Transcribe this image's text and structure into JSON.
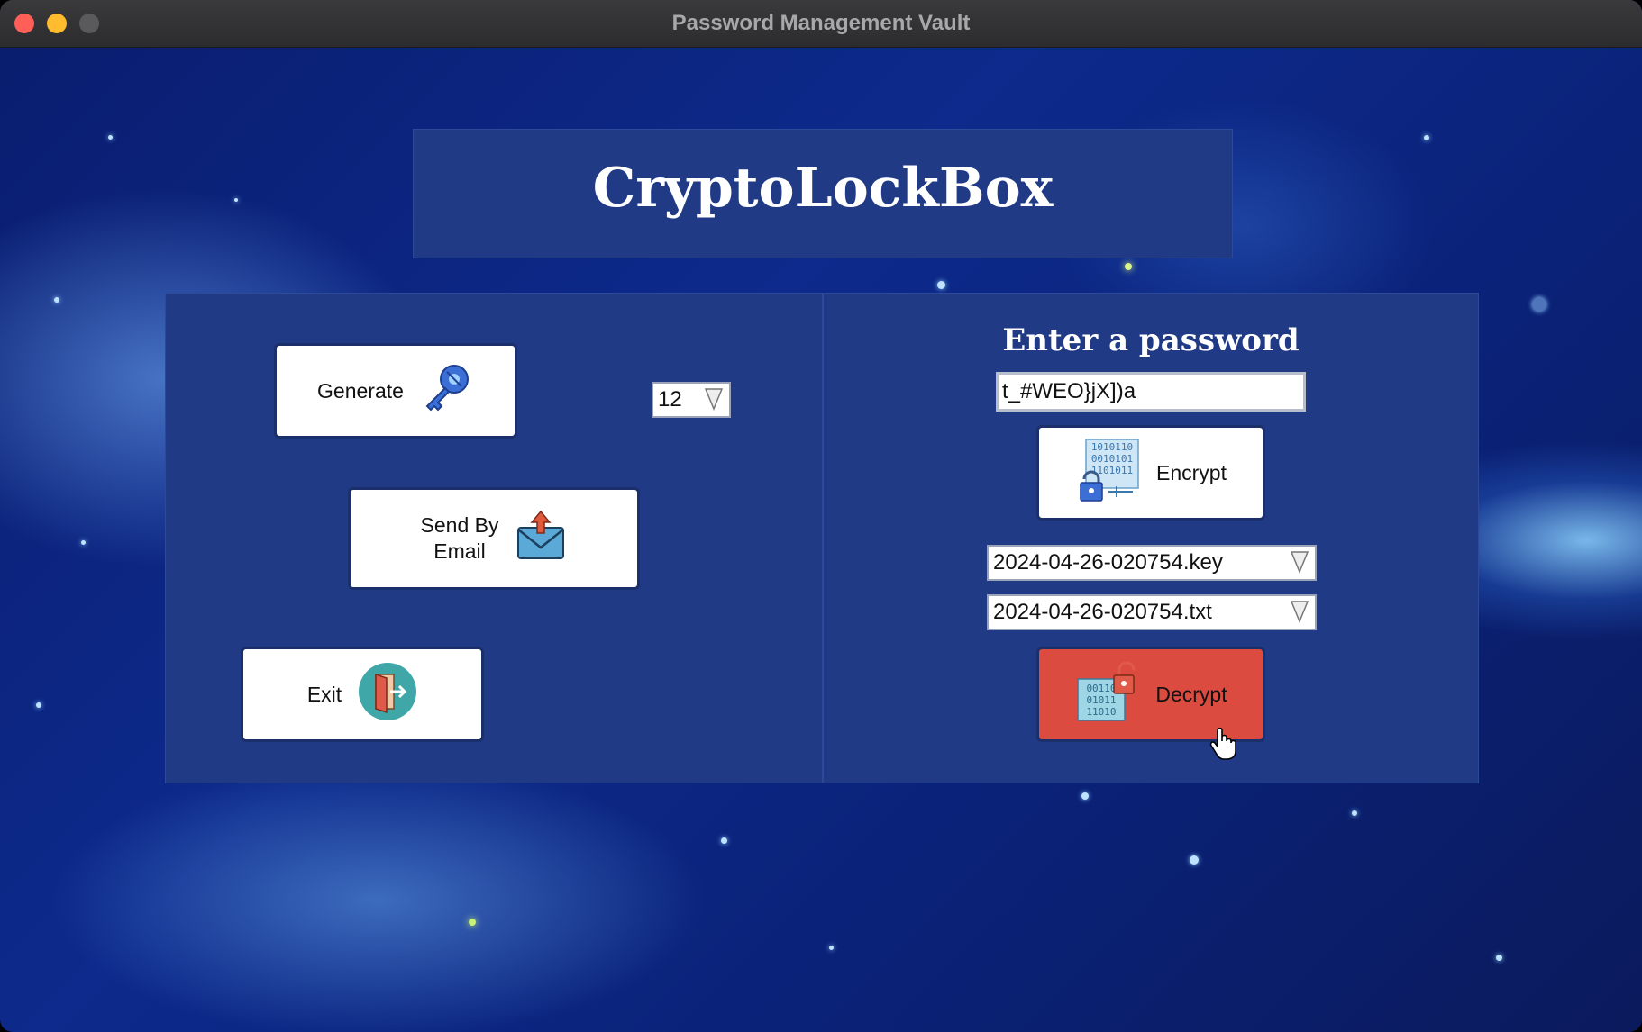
{
  "window": {
    "title": "Password Management Vault"
  },
  "brand": {
    "title": "CryptoLockBox"
  },
  "left": {
    "generate_label": "Generate",
    "length_value": "12",
    "send_label_line1": "Send By",
    "send_label_line2": "Email",
    "exit_label": "Exit"
  },
  "right": {
    "heading": "Enter a password",
    "password_value": "t_#WEO}jX])a",
    "encrypt_label": "Encrypt",
    "key_file": "2024-04-26-020754.key",
    "txt_file": "2024-04-26-020754.txt",
    "decrypt_label": "Decrypt"
  },
  "colors": {
    "panel": "#213a85",
    "decrypt_button": "#dc4b3f",
    "background": "#0d2a8c"
  },
  "icons": {
    "generate": "key-icon",
    "send": "envelope-upload-icon",
    "exit": "door-exit-icon",
    "encrypt": "binary-lock-icon",
    "decrypt": "binary-unlock-icon"
  }
}
